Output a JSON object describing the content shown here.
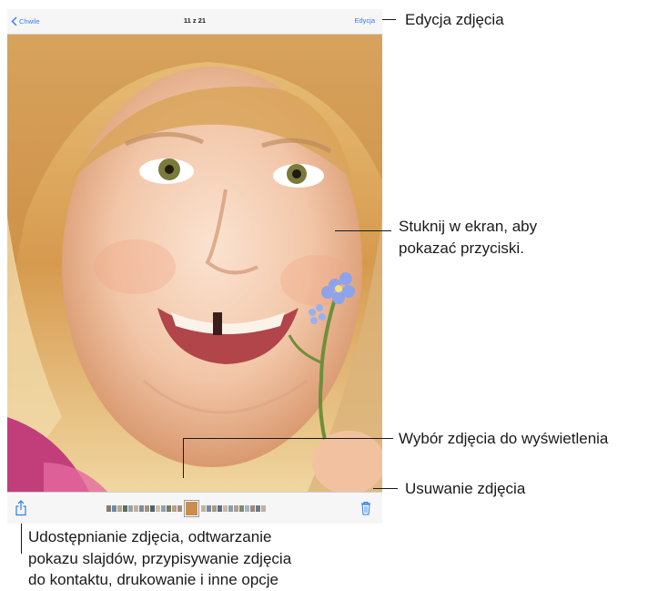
{
  "device": {
    "topbar": {
      "back_label": "Chwile",
      "counter": "11 z 21",
      "edit_label": "Edycja"
    },
    "icons": {
      "back": "chevron-left-icon",
      "share": "share-icon",
      "trash": "trash-icon"
    },
    "accent_color": "#2f7cf6"
  },
  "callouts": {
    "edit": "Edycja zdjęcia",
    "tap_line1": "Stuknij w ekran, aby",
    "tap_line2": "pokazać przyciski.",
    "select": "Wybór zdjęcia do wyświetlenia",
    "delete": "Usuwanie zdjęcia",
    "share_line1": "Udostępnianie zdjęcia, odtwarzanie",
    "share_line2": "pokazu slajdów, przypisywanie zdjęcia",
    "share_line3": "do kontaktu, drukowanie i inne opcje"
  }
}
